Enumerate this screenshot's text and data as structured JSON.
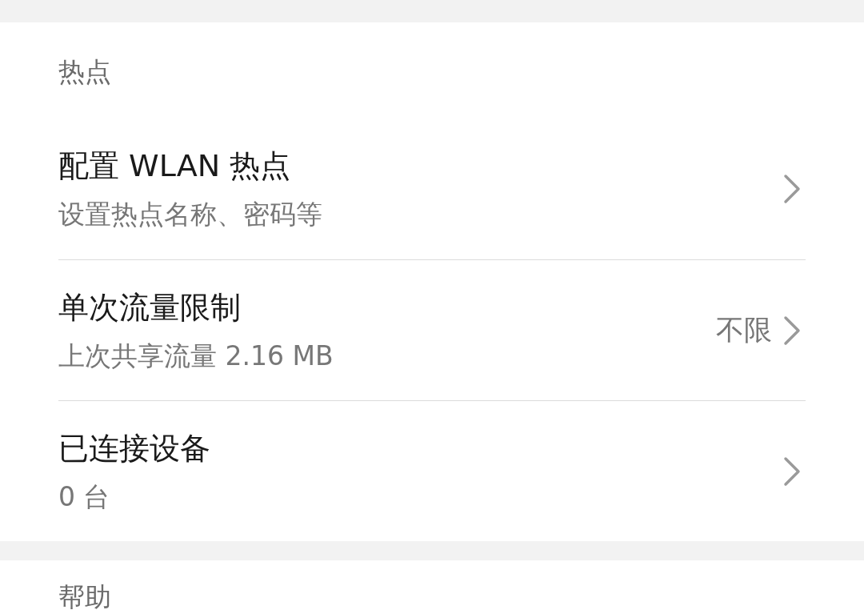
{
  "sections": [
    {
      "header": "热点",
      "items": [
        {
          "title": "配置 WLAN 热点",
          "subtitle": "设置热点名称、密码等"
        },
        {
          "title": "单次流量限制",
          "subtitle": "上次共享流量 2.16 MB",
          "value": "不限"
        },
        {
          "title": "已连接设备",
          "subtitle": "0 台"
        }
      ]
    },
    {
      "header": "帮助"
    }
  ]
}
